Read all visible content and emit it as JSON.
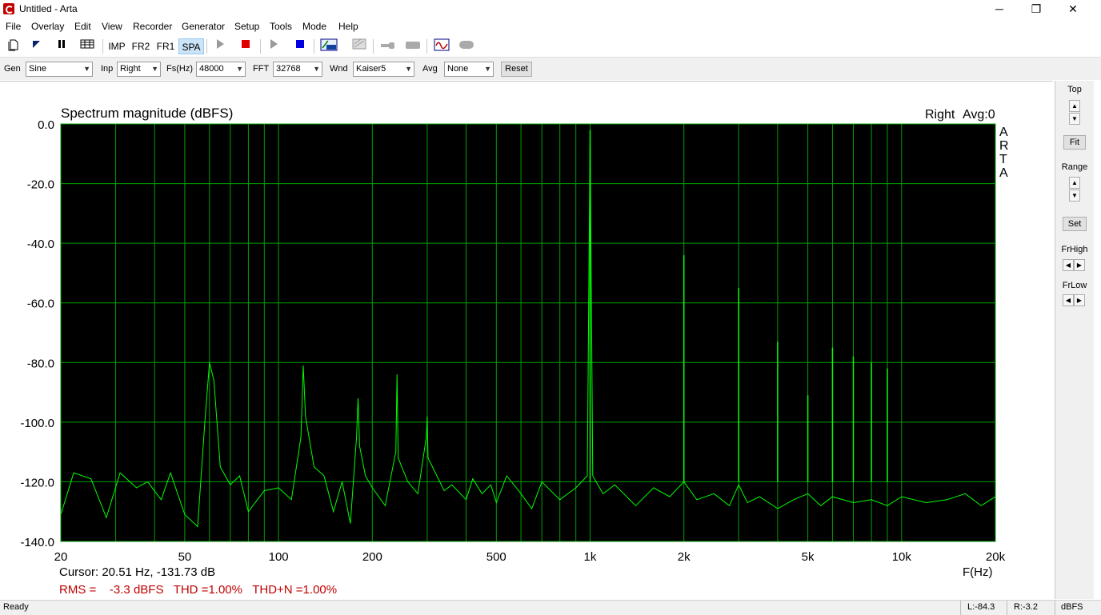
{
  "window": {
    "title": "Untitled - Arta",
    "minimize_glyph": "─",
    "restore_glyph": "❐",
    "close_glyph": "✕"
  },
  "menu": [
    "File",
    "Overlay",
    "Edit",
    "View",
    "Recorder",
    "Generator",
    "Setup",
    "Tools",
    "Mode",
    "Help"
  ],
  "toolbar": {
    "modes": [
      "IMP",
      "FR2",
      "FR1",
      "SPA"
    ],
    "active_mode": "SPA",
    "icons": [
      "new-file-icon",
      "open-icon",
      "pause-icon",
      "grid-icon",
      "play-icon",
      "stop-icon",
      "play-generator-icon",
      "stop-generator-icon",
      "abc-icon",
      "scope-icon",
      "probe-icon",
      "tape-icon",
      "waveform-icon",
      "toggle-icon"
    ]
  },
  "controls": {
    "gen_label": "Gen",
    "gen_value": "Sine",
    "inp_label": "Inp",
    "inp_value": "Right",
    "fs_label": "Fs(Hz)",
    "fs_value": "48000",
    "fft_label": "FFT",
    "fft_value": "32768",
    "wnd_label": "Wnd",
    "wnd_value": "Kaiser5",
    "avg_label": "Avg",
    "avg_value": "None",
    "reset_label": "Reset"
  },
  "plot": {
    "title": "Spectrum magnitude (dBFS)",
    "channel": "Right",
    "avg": "Avg:0",
    "watermark": [
      "A",
      "R",
      "T",
      "A"
    ],
    "xlabel": "F(Hz)",
    "cursor": "Cursor: 20.51 Hz, -131.73 dB",
    "metrics": "RMS =    -3.3 dBFS   THD =1.00%   THD+N =1.00%",
    "colors": {
      "background": "#000000",
      "grid": "#00a000",
      "trace": "#00ff00",
      "metrics": "#c00000"
    }
  },
  "chart_data": {
    "type": "line",
    "title": "Spectrum magnitude (dBFS)",
    "xlabel": "F(Hz)",
    "ylabel": "",
    "x_scale": "log",
    "xlim": [
      20,
      20000
    ],
    "ylim": [
      -140,
      0
    ],
    "grid": true,
    "x_tick_labels": [
      "20",
      "50",
      "100",
      "200",
      "500",
      "1k",
      "2k",
      "5k",
      "10k",
      "20k"
    ],
    "y_tick_labels": [
      "0.0",
      "-20.0",
      "-40.0",
      "-60.0",
      "-80.0",
      "-100.0",
      "-120.0",
      "-140.0"
    ],
    "series": [
      {
        "x": [
          20,
          22,
          25,
          28,
          31,
          35,
          38,
          42,
          45,
          50,
          55,
          58,
          60,
          62,
          65,
          70,
          75,
          80,
          90,
          100,
          110,
          118,
          120,
          122,
          130,
          140,
          150,
          160,
          170,
          178,
          180,
          182,
          190,
          200,
          220,
          238,
          240,
          242,
          260,
          280,
          298,
          300,
          302,
          340,
          360,
          400,
          420,
          450,
          480,
          500,
          540,
          600,
          650,
          700,
          800,
          900,
          980,
          1000,
          1020,
          1100,
          1200,
          1400,
          1600,
          1800,
          2000,
          2200,
          2500,
          2800,
          3000,
          3200,
          3500,
          4000,
          4500,
          5000,
          5500,
          6000,
          7000,
          8000,
          9000,
          10000,
          12000,
          14000,
          16000,
          18000,
          20000
        ],
        "y": [
          -131,
          -117,
          -119,
          -132,
          -117,
          -122,
          -120,
          -126,
          -117,
          -131,
          -135,
          -100,
          -80,
          -86,
          -115,
          -121,
          -118,
          -130,
          -123,
          -122,
          -126,
          -105,
          -81,
          -98,
          -115,
          -118,
          -130,
          -120,
          -134,
          -105,
          -92,
          -108,
          -118,
          -122,
          -128,
          -110,
          -84,
          -112,
          -120,
          -124,
          -105,
          -98,
          -112,
          -123,
          -121,
          -126,
          -119,
          -124,
          -121,
          -127,
          -118,
          -124,
          -129,
          -120,
          -126,
          -122,
          -118,
          -2,
          -118,
          -124,
          -121,
          -128,
          -122,
          -125,
          -120,
          -126,
          -124,
          -128,
          -121,
          -127,
          -125,
          -129,
          -126,
          -124,
          -128,
          -125,
          -127,
          -126,
          -128,
          -125,
          -127,
          -126,
          -124,
          -128,
          -125
        ]
      }
    ],
    "harmonics": [
      {
        "x": 1000,
        "y": -2
      },
      {
        "x": 2000,
        "y": -44
      },
      {
        "x": 3000,
        "y": -55
      },
      {
        "x": 4000,
        "y": -73
      },
      {
        "x": 5000,
        "y": -91
      },
      {
        "x": 6000,
        "y": -75
      },
      {
        "x": 7000,
        "y": -78
      },
      {
        "x": 8000,
        "y": -80
      },
      {
        "x": 9000,
        "y": -82
      }
    ]
  },
  "side": {
    "top_label": "Top",
    "fit_label": "Fit",
    "range_label": "Range",
    "set_label": "Set",
    "frhigh_label": "FrHigh",
    "frlow_label": "FrLow"
  },
  "status": {
    "ready": "Ready",
    "left": "L:-84.3",
    "right": "R:-3.2",
    "unit": "dBFS"
  }
}
